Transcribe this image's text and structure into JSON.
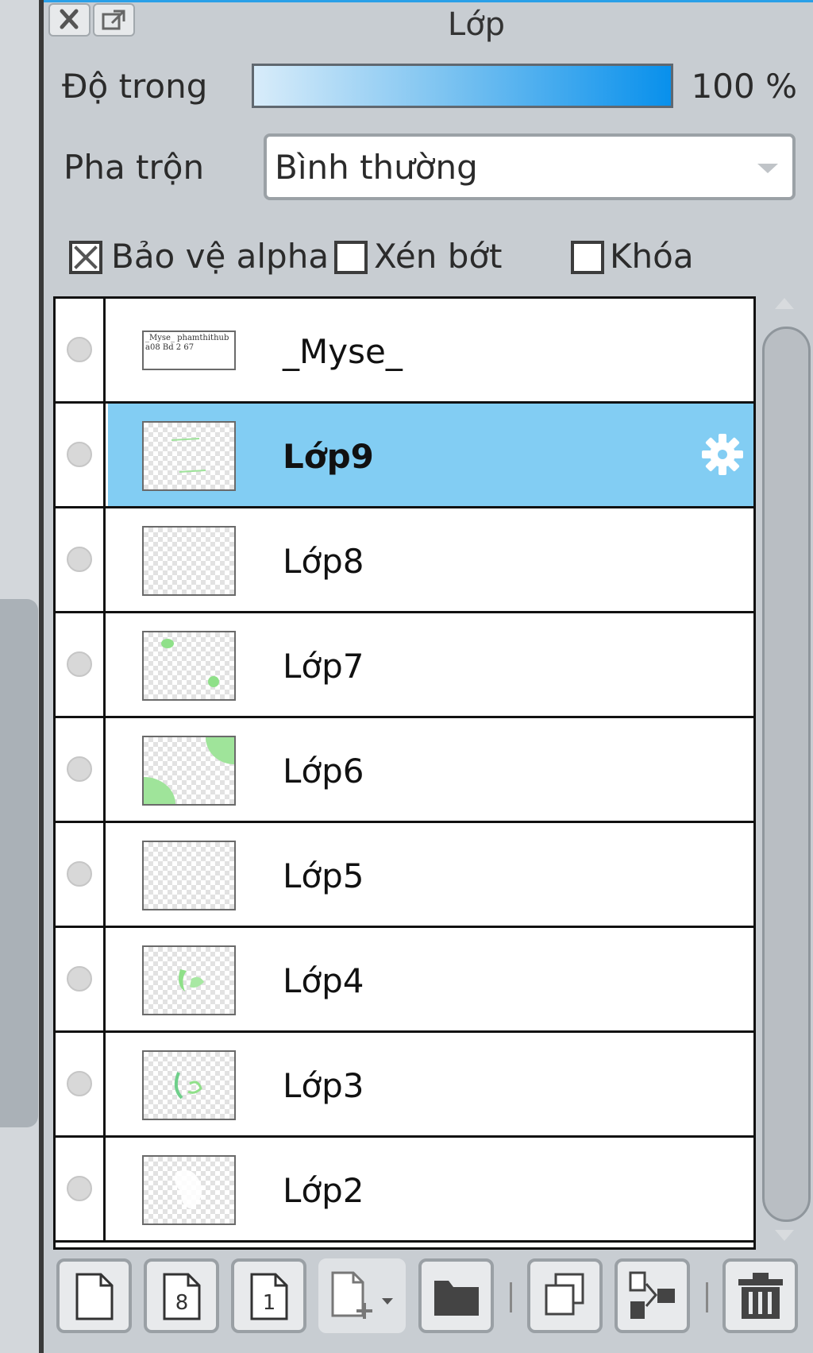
{
  "panel": {
    "title": "Lớp"
  },
  "opacity": {
    "label": "Độ trong",
    "value": "100 %",
    "level": 1.0
  },
  "blend": {
    "label": "Pha trộn",
    "selected": "Bình thường"
  },
  "options": [
    {
      "label": "Bảo vệ alpha",
      "checked": true
    },
    {
      "label": "Xén bớt",
      "checked": false
    },
    {
      "label": "Khóa",
      "checked": false
    }
  ],
  "thumb_text": "_Myse_ phamthithuba08 Bd 2 67",
  "layers": [
    {
      "name": "_Myse_",
      "selected": false
    },
    {
      "name": "Lớp9",
      "selected": true,
      "icon": "gear-icon"
    },
    {
      "name": "Lớp8",
      "selected": false
    },
    {
      "name": "Lớp7",
      "selected": false
    },
    {
      "name": "Lớp6",
      "selected": false
    },
    {
      "name": "Lớp5",
      "selected": false
    },
    {
      "name": "Lớp4",
      "selected": false
    },
    {
      "name": "Lớp3",
      "selected": false
    },
    {
      "name": "Lớp2",
      "selected": false
    }
  ],
  "toolbar": {
    "buttons": [
      "new-layer-icon",
      "new-8bit-layer-icon",
      "new-1bit-layer-icon",
      "add-layer-menu-icon",
      "new-folder-icon",
      "duplicate-layer-icon",
      "merge-down-icon",
      "delete-layer-icon"
    ],
    "page8_text": "8",
    "page1_text": "1"
  },
  "colors": {
    "selection": "#82cdf3",
    "opacity_bar_end": "#0890ec",
    "accent": "#2aa0e8"
  }
}
